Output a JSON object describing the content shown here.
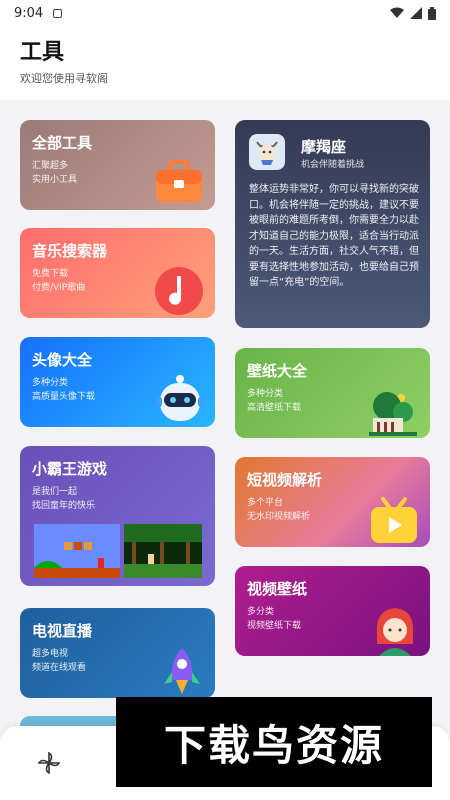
{
  "status_bar": {
    "time": "9:04",
    "icons": [
      "notification-icon",
      "wifi-icon",
      "signal-icon",
      "battery-icon"
    ]
  },
  "header": {
    "title": "工具",
    "subtitle": "欢迎您使用寻软阁"
  },
  "cards": {
    "tools": {
      "title": "全部工具",
      "line1": "汇聚超多",
      "line2": "实用小工具",
      "icon": "toolbox-icon"
    },
    "music": {
      "title": "音乐搜索器",
      "line1": "免费下载",
      "line2": "付费/VIP歌曲",
      "icon": "music-note-icon"
    },
    "avatar": {
      "title": "头像大全",
      "line1": "多种分类",
      "line2": "高质量头像下载",
      "icon": "robot-icon"
    },
    "game": {
      "title": "小霸王游戏",
      "line1": "是我们一起",
      "line2": "找回童年的快乐",
      "icon": "retro-game-screens"
    },
    "tv": {
      "title": "电视直播",
      "line1": "超多电视",
      "line2": "频道在线观看",
      "icon": "rocket-icon"
    },
    "horoscope": {
      "title": "摩羯座",
      "subtitle": "机会伴随着挑战",
      "text": "整体运势非常好，你可以寻找新的突破口。机会将伴随一定的挑战，建议不要被眼前的难题所考倒，你需要全力以赴才知道自己的能力极限，适合当行动派的一天。生活方面，社交人气不错，但要有选择性地参加活动，也要给自己预留一点“充电”的空间。",
      "icon": "capricorn-avatar-icon"
    },
    "wallpaper": {
      "title": "壁纸大全",
      "line1": "多种分类",
      "line2": "高清壁纸下载",
      "icon": "tree-house-icon"
    },
    "video_parse": {
      "title": "短视频解析",
      "line1": "多个平台",
      "line2": "无水印视频解析",
      "icon": "video-play-icon"
    },
    "video_wallpaper": {
      "title": "视频壁纸",
      "line1": "多分类",
      "line2": "视频壁纸下载",
      "icon": "girl-avatar-icon"
    }
  },
  "bottom_nav": {
    "icon": "pinwheel-icon"
  },
  "watermark": {
    "text": "下载鸟资源"
  },
  "colors": {
    "background": "#f3f3f5",
    "watermark_bg": "#000000"
  }
}
